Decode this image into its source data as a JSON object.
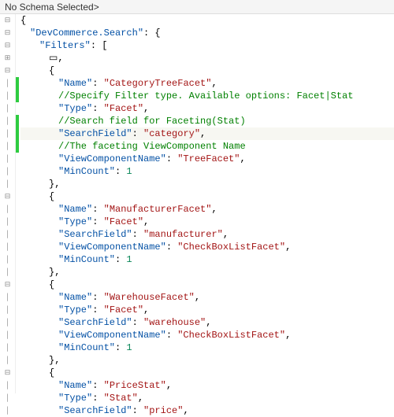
{
  "header": {
    "title": "No Schema Selected>"
  },
  "gutter": {
    "minus": "⊟",
    "plus": "⊞",
    "pipe": "│"
  },
  "json": {
    "rootKey": "DevCommerce.Search",
    "filtersKey": "Filters",
    "openBrace": "{",
    "closeBrace": "}",
    "openBracket": "[",
    "closeBracket": "]",
    "comma": ",",
    "colon": ": ",
    "quote": "\"",
    "collapsedBox": "▭",
    "comments": {
      "filterType": "//Specify Filter type. Available options: Facet|Stat",
      "searchField": "//Search field for Faceting(Stat)",
      "viewComponent": "//The faceting ViewComponent Name"
    },
    "keys": {
      "name": "Name",
      "type": "Type",
      "searchField": "SearchField",
      "viewComponentName": "ViewComponentName",
      "minCount": "MinCount"
    },
    "filters": [
      {
        "name": "CategoryTreeFacet",
        "type": "Facet",
        "searchField": "category",
        "viewComponentName": "TreeFacet",
        "minCount": 1,
        "showComments": true
      },
      {
        "name": "ManufacturerFacet",
        "type": "Facet",
        "searchField": "manufacturer",
        "viewComponentName": "CheckBoxListFacet",
        "minCount": 1
      },
      {
        "name": "WarehouseFacet",
        "type": "Facet",
        "searchField": "warehouse",
        "viewComponentName": "CheckBoxListFacet",
        "minCount": 1
      },
      {
        "name": "PriceStat",
        "type": "Stat",
        "searchField": "price"
      }
    ]
  }
}
